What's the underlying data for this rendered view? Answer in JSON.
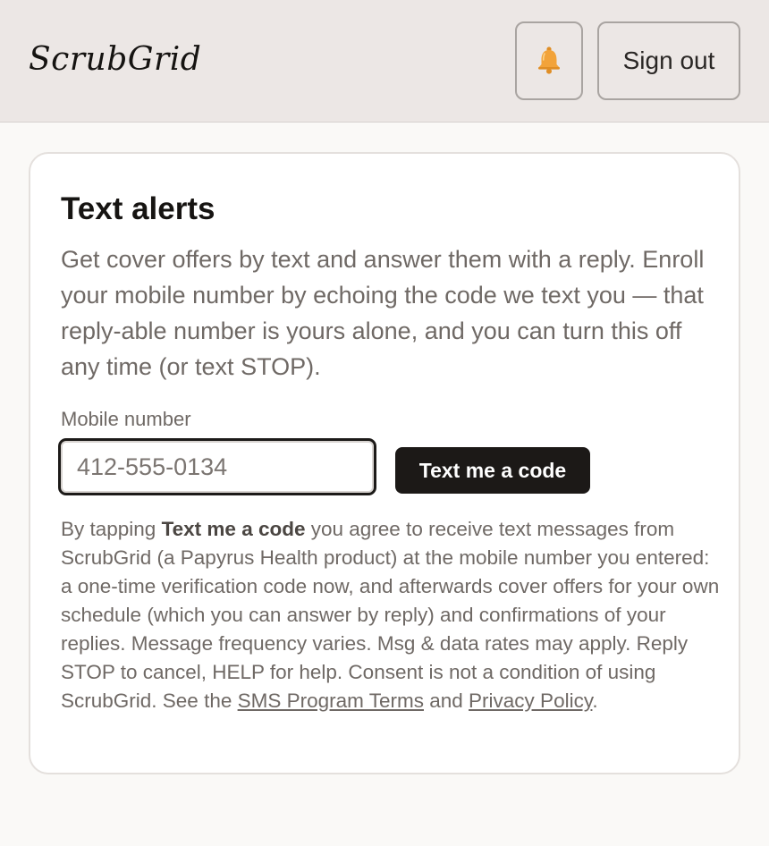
{
  "header": {
    "brand": "ScrubGrid",
    "bell_icon": "bell-icon",
    "sign_out_label": "Sign out"
  },
  "card": {
    "title": "Text alerts",
    "description": "Get cover offers by text and answer them with a reply. Enroll your mobile number by echoing the code we text you — that reply-able number is yours alone, and you can turn this off any time (or text STOP).",
    "field_label": "Mobile number",
    "input_placeholder": "412-555-0134",
    "input_value": "",
    "button_label": "Text me a code",
    "consent": {
      "prefix": "By tapping ",
      "bold": "Text me a code",
      "body": " you agree to receive text messages from ScrubGrid (a Papyrus Health product) at the mobile number you entered: a one-time verification code now, and afterwards cover offers for your own schedule (which you can answer by reply) and confirmations of your replies. Message frequency varies. Msg & data rates may apply. Reply STOP to cancel, HELP for help. Consent is not a condition of using ScrubGrid. See the ",
      "terms_link": "SMS Program Terms",
      "and": " and ",
      "privacy_link": "Privacy Policy",
      "suffix": "."
    }
  },
  "colors": {
    "header_bg": "#ece7e5",
    "page_bg": "#faf9f7",
    "button_bg": "#1c1917",
    "muted_text": "#6f6965",
    "bell": "#f2a33a"
  }
}
